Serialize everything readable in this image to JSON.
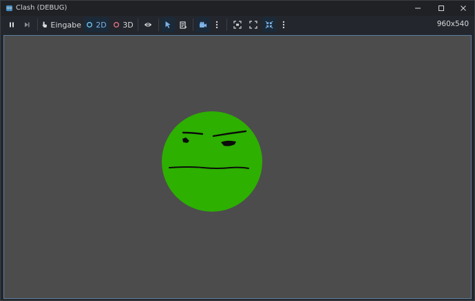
{
  "window": {
    "title": "Clash (DEBUG)"
  },
  "toolbar": {
    "input_label": "Eingabe",
    "mode_2d_label": "2D",
    "mode_3d_label": "3D",
    "resolution": "960x540"
  },
  "colors": {
    "face_fill": "#2db000",
    "canvas_bg": "#4c4c4c",
    "accent_blue": "#7fb3e8",
    "mode_2d_ring": "#6fc3f0",
    "mode_3d_ring": "#e07080"
  },
  "icons": {
    "app": "godot-icon",
    "pause": "pause-icon",
    "next_frame": "next-frame-icon",
    "input": "input-icon",
    "visibility": "eye-icon",
    "select": "pointer-icon",
    "list": "list-icon",
    "camera": "camera-icon",
    "more": "kebab-icon"
  }
}
